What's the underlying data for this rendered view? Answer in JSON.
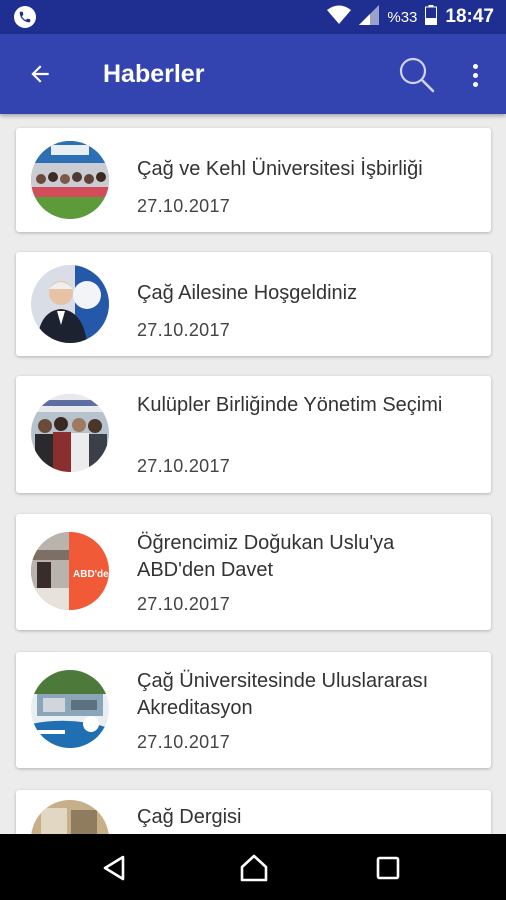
{
  "status_bar": {
    "battery_percent": "%33",
    "time": "18:47",
    "icons": [
      "phone-call-icon",
      "wifi-icon",
      "signal-icon",
      "battery-icon"
    ]
  },
  "app_bar": {
    "title": "Haberler",
    "icons": [
      "back-arrow-icon",
      "search-icon",
      "more-vert-icon"
    ]
  },
  "news": [
    {
      "title": "Çağ ve Kehl Üniversitesi İşbirliği",
      "date": "27.10.2017"
    },
    {
      "title": "Çağ Ailesine Hoşgeldiniz",
      "date": "27.10.2017"
    },
    {
      "title": "Kulüpler Birliğinde Yönetim Seçimi",
      "date": "27.10.2017"
    },
    {
      "title": "Öğrencimiz Doğukan Uslu'ya ABD'den Davet",
      "date": "27.10.2017"
    },
    {
      "title": "Çağ Üniversitesinde Uluslararası Akreditasyon",
      "date": "27.10.2017"
    },
    {
      "title": "Çağ Dergisi",
      "date": ""
    }
  ],
  "thumb_texts": {
    "item4": "ABD'den"
  },
  "colors": {
    "app_bar": "#3343b0",
    "status_bar": "#1f2f91",
    "background": "#ececec"
  },
  "nav_bar": {
    "icons": [
      "back-triangle-icon",
      "home-icon",
      "recents-square-icon"
    ]
  }
}
